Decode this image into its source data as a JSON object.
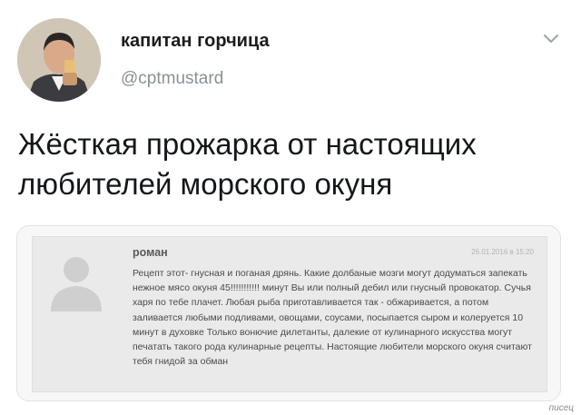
{
  "tweet": {
    "author_name": "капитан горчица",
    "handle": "@cptmustard",
    "text": "Жёсткая прожарка от настоящих любителей морского окуня"
  },
  "comment": {
    "author": "роман",
    "date": "26.01.2016 в 15:20",
    "body": "Рецепт этот- гнусная и поганая дрянь. Какие долбаные мозги могут додуматься запекать нежное мясо окуня 45!!!!!!!!!!! минут Вы или полный дебил или гнусный провокатор. Сучья харя по тебе плачет. Любая рыба приготавливается так - обжаривается, а потом заливается любыми подливами, овощами, соусами, посыпается сыром и колеруется 10 минут в духовке Только вонючие дилетанты, далекие от кулинарного искусства могут печатать такого рода кулинарные рецепты. Настоящие любители морского окуня считают тебя гнидой за обман"
  },
  "watermark": "писец",
  "icons": {
    "menu": "chevron-down-icon",
    "comment_avatar": "user-silhouette-icon"
  },
  "colors": {
    "text": "#14171a",
    "handle": "#8a9096",
    "card_border": "#dfe3e6"
  }
}
